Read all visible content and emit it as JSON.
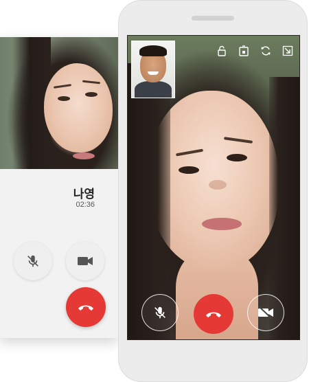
{
  "voice_call": {
    "contact_name": "나영",
    "duration": "02:36",
    "buttons": {
      "mute": "mic-off-icon",
      "video": "video-camera-icon",
      "end_call": "hang-up-icon"
    }
  },
  "video_call": {
    "top_icons": [
      "unlock-icon",
      "screen-rotate-lock-icon",
      "switch-camera-icon",
      "minimize-icon"
    ],
    "buttons": {
      "mute": "mic-off-icon",
      "end_call": "hang-up-icon",
      "video_off": "video-off-icon"
    }
  },
  "colors": {
    "end_call": "#e53935",
    "phone_body": "#ececec",
    "card_bg": "#f2f2f2"
  }
}
